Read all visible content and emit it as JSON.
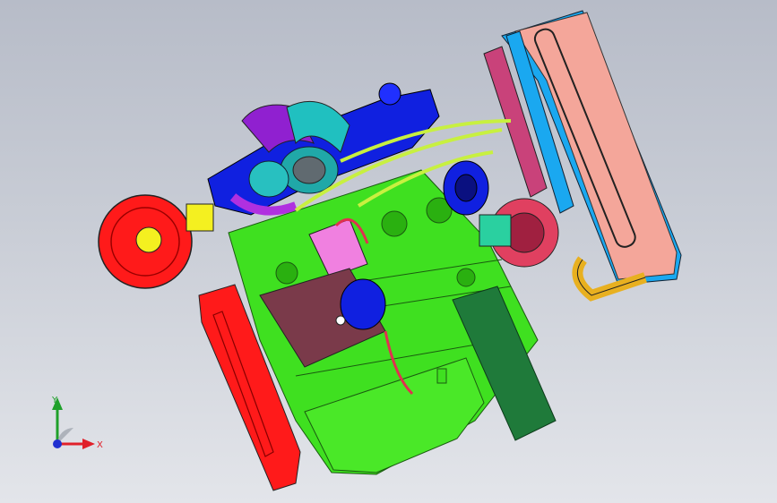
{
  "viewport": {
    "background_top": "#b7bcc8",
    "background_bottom": "#e3e5ea"
  },
  "triad": {
    "x_label": "X",
    "y_label": "Y",
    "x_color": "#e0202a",
    "y_color": "#1fa02a",
    "z_color": "#2030d0"
  },
  "model": {
    "engine_block_color": "#3fe020",
    "flywheel_housing_color": "#ff1a1a",
    "air_filter_color": "#ff1a1a",
    "intake_manifold_color": "#1020e0",
    "turbo_color": "#1aa0a0",
    "radiator_color": "#f4a69a",
    "radiator_frame_color": "#1aa8f0",
    "starter_color": "#7a3a4a",
    "bracket_color": "#1f7a3a"
  }
}
